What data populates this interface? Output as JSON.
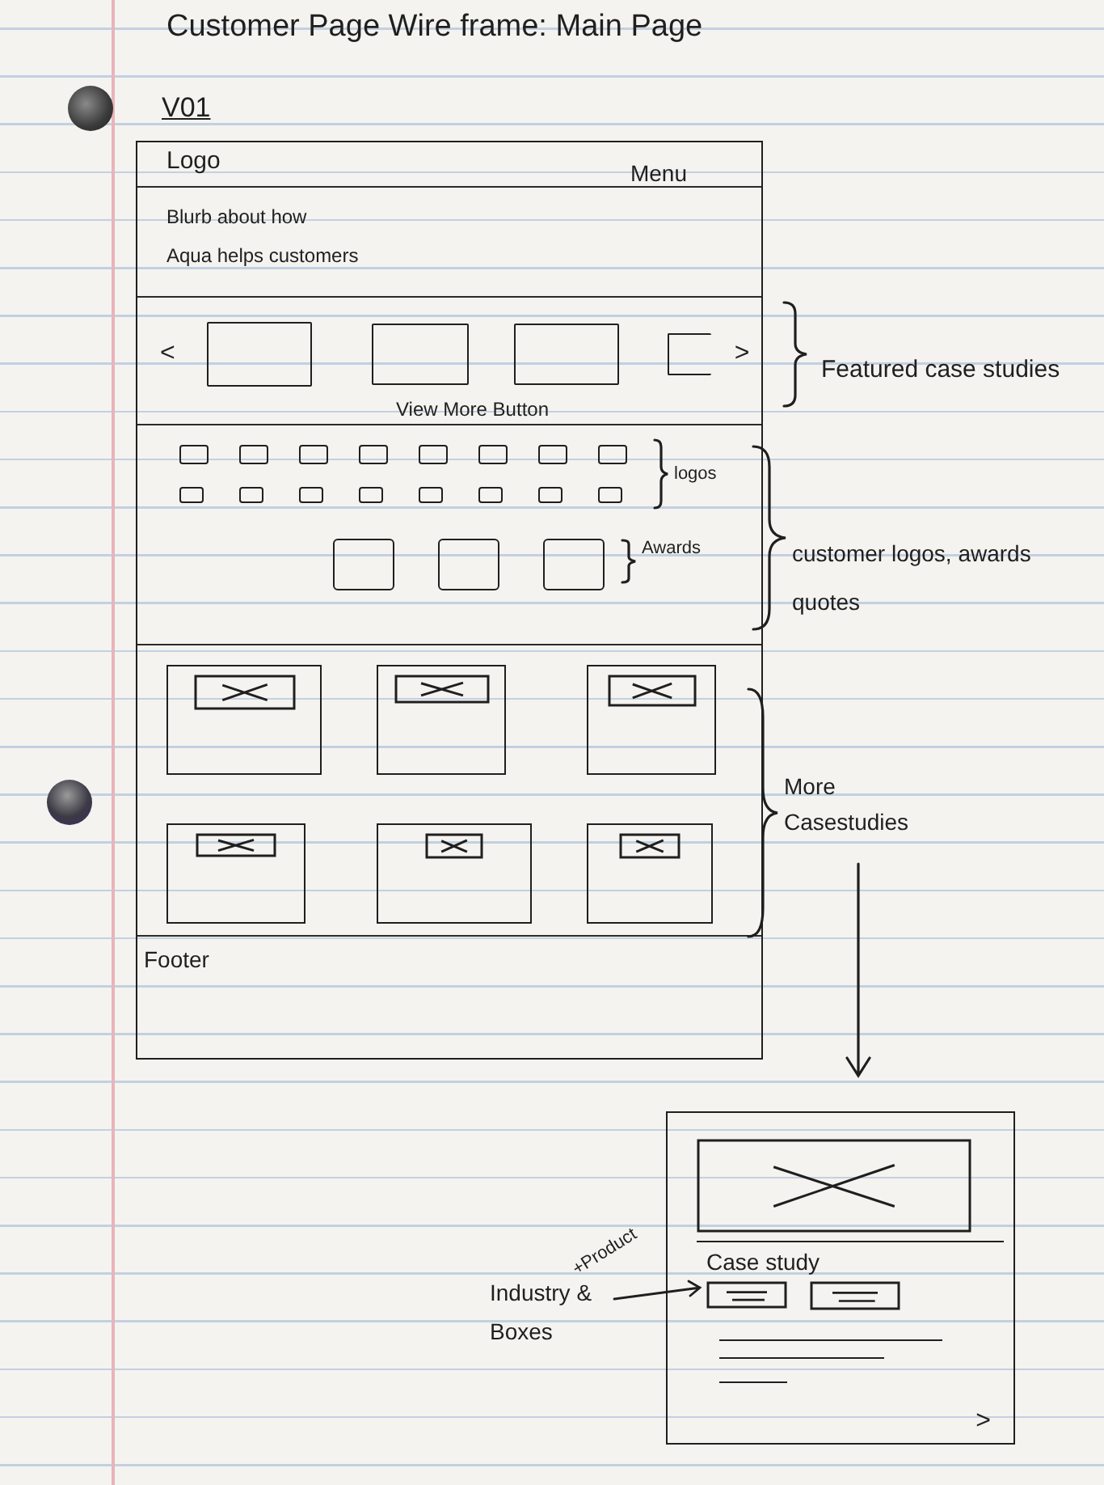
{
  "title": "Customer Page Wire frame: Main Page",
  "version": "V01",
  "wireframe": {
    "header": {
      "logo": "Logo",
      "menu": "Menu"
    },
    "blurb": [
      "Blurb about how",
      "Aqua helps customers"
    ],
    "carousel": {
      "prev": "<",
      "next": ">",
      "button_label": "View More Button"
    },
    "logos_label": "logos",
    "awards_label": "Awards",
    "footer": "Footer"
  },
  "annotations": [
    {
      "lines": [
        "Featured case studies"
      ]
    },
    {
      "lines": [
        "customer logos, awards",
        "quotes"
      ]
    },
    {
      "lines": [
        "More",
        "Casestudies"
      ]
    }
  ],
  "detail_card": {
    "heading": "Case study",
    "next": ">",
    "callout": {
      "lines": [
        "Industry &",
        "Boxes"
      ],
      "note": "+Product"
    }
  }
}
